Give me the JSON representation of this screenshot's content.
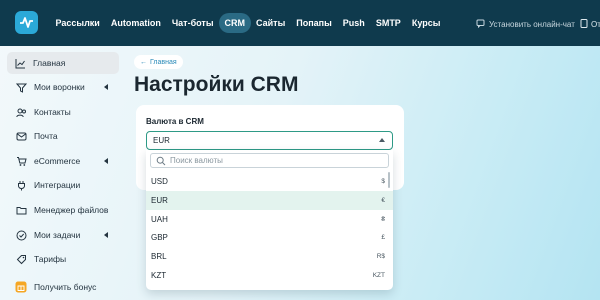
{
  "nav": {
    "items": [
      "Рассылки",
      "Automation",
      "Чат-боты",
      "CRM",
      "Сайты",
      "Попапы",
      "Push",
      "SMTP",
      "Курсы"
    ],
    "active_index": 3,
    "chat_link": "Установить онлайн-чат",
    "cut_item": "От"
  },
  "sidebar": {
    "items": [
      {
        "label": "Главная",
        "icon": "chart-line-icon"
      },
      {
        "label": "Мои воронки",
        "icon": "funnel-icon"
      },
      {
        "label": "Контакты",
        "icon": "contacts-icon"
      },
      {
        "label": "Почта",
        "icon": "mail-icon"
      },
      {
        "label": "eCommerce",
        "icon": "cart-icon"
      },
      {
        "label": "Интеграции",
        "icon": "integrations-icon"
      },
      {
        "label": "Менеджер файлов",
        "icon": "folder-icon"
      },
      {
        "label": "Мои задачи",
        "icon": "tasks-icon"
      },
      {
        "label": "Тарифы",
        "icon": "tariffs-icon"
      },
      {
        "label": "Получить бонус",
        "icon": "gift-icon"
      }
    ]
  },
  "breadcrumb": {
    "label": "Главная"
  },
  "page": {
    "title": "Настройки CRM"
  },
  "currency": {
    "label": "Валюта в CRM",
    "value": "EUR",
    "search_placeholder": "Поиск валюты",
    "options": [
      {
        "code": "USD",
        "symbol": "$"
      },
      {
        "code": "EUR",
        "symbol": "€"
      },
      {
        "code": "UAH",
        "symbol": "₴"
      },
      {
        "code": "GBP",
        "symbol": "£"
      },
      {
        "code": "BRL",
        "symbol": "R$"
      },
      {
        "code": "KZT",
        "symbol": "KZT"
      }
    ],
    "selected_index": 1
  },
  "colors": {
    "topbar": "#0f3a4d",
    "accent": "#2ba9d8",
    "active_nav": "#2a6a84",
    "select_border": "#2e9a86"
  }
}
